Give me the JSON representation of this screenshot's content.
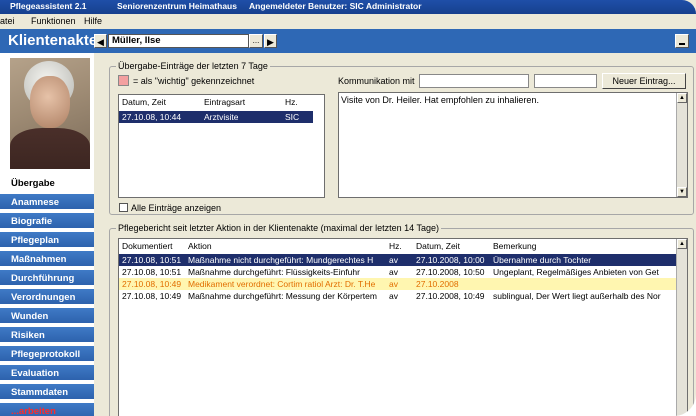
{
  "titlebar": {
    "app": "Pflegeassistent 2.1",
    "facility": "Seniorenzentrum Heimathaus",
    "user": "Angemeldeter Benutzer: SIC Administrator"
  },
  "menu": [
    "atei",
    "Funktionen",
    "Hilfe"
  ],
  "header": {
    "title": "Klientenakte",
    "client_name": "Müller, Ilse",
    "ellipsis": "..."
  },
  "nav": [
    {
      "label": "Übergabe",
      "active": true
    },
    {
      "label": "Anamnese"
    },
    {
      "label": "Biografie"
    },
    {
      "label": "Pflegeplan"
    },
    {
      "label": "Maßnahmen"
    },
    {
      "label": "Durchführung"
    },
    {
      "label": "Verordnungen"
    },
    {
      "label": "Wunden"
    },
    {
      "label": "Risiken"
    },
    {
      "label": "Pflegeprotokoll"
    },
    {
      "label": "Evaluation"
    },
    {
      "label": "Stammdaten"
    },
    {
      "label": "...arbeiten"
    }
  ],
  "handover": {
    "group_title": "Übergabe-Einträge der letzten 7 Tage",
    "important_note": "= als \"wichtig\" gekennzeichnet",
    "columns": [
      "Datum, Zeit",
      "Eintragsart",
      "Hz."
    ],
    "rows": [
      {
        "datetime": "27.10.08, 10:44",
        "type": "Arztvisite",
        "hz": "SIC"
      }
    ],
    "communication_label": "Kommunikation mit",
    "new_entry_button": "Neuer Eintrag...",
    "text": "Visite von Dr. Heiler. Hat empfohlen zu inhalieren.",
    "show_all_label": "Alle Einträge anzeigen"
  },
  "report": {
    "group_title": "Pflegebericht seit letzter Aktion in der Klientenakte (maximal der letzten 14 Tage)",
    "columns": [
      "Dokumentiert",
      "Aktion",
      "Hz.",
      "Datum, Zeit",
      "Bemerkung"
    ],
    "rows": [
      {
        "doc": "27.10.08, 10:51",
        "action": "Maßnahme nicht durchgeführt: Mundgerechtes H",
        "hz": "av",
        "date": "27.10.2008, 10:00",
        "note": "Übernahme durch Tochter",
        "style": "selected"
      },
      {
        "doc": "27.10.08, 10:51",
        "action": "Maßnahme durchgeführt: Flüssigkeits-Einfuhr",
        "hz": "av",
        "date": "27.10.2008, 10:50",
        "note": "Ungeplant, Regelmäßiges Anbieten von Get",
        "style": "normal"
      },
      {
        "doc": "27.10.08, 10:49",
        "action": "Medikament verordnet: Cortim ratiol Arzt: Dr. T.He",
        "hz": "av",
        "date": "27.10.2008",
        "note": "",
        "style": "warning"
      },
      {
        "doc": "27.10.08, 10:49",
        "action": "Maßnahme durchgeführt: Messung der Körpertem",
        "hz": "av",
        "date": "27.10.2008, 10:49",
        "note": "sublingual, Der Wert liegt außerhalb des Nor",
        "style": "normal"
      }
    ]
  },
  "colors": {
    "header_blue": "#2e68b5",
    "selected_row": "#1e2e6b",
    "warning_row": "#fff6b0",
    "warning_text": "#e16e00",
    "important_marker": "#f3a0a0"
  }
}
